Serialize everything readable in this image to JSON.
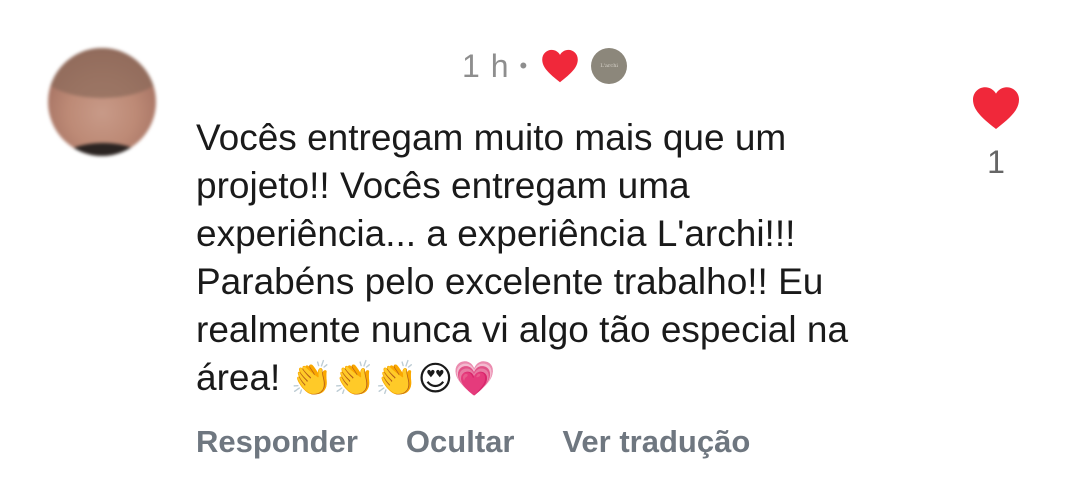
{
  "comment": {
    "time": "1 h",
    "separator": "•",
    "creator_avatar_text": "L'archi",
    "text": "Vocês entregam muito mais que um projeto!! Vocês entregam uma experiência... a experiência L'archi!!! Parabéns pelo excelente trabalho!! Eu realmente nunca vi algo tão especial na área!",
    "emojis": "👏👏👏😍💗",
    "like_count": "1",
    "liked_by_creator_icon": "heart-icon",
    "like_icon": "heart-icon"
  },
  "actions": {
    "reply_label": "Responder",
    "hide_label": "Ocultar",
    "translate_label": "Ver tradução"
  },
  "colors": {
    "heart": "#f0283a",
    "action_text": "#6f7780",
    "meta_text": "#8e8e8e",
    "creator_avatar_bg": "#8c877b"
  }
}
